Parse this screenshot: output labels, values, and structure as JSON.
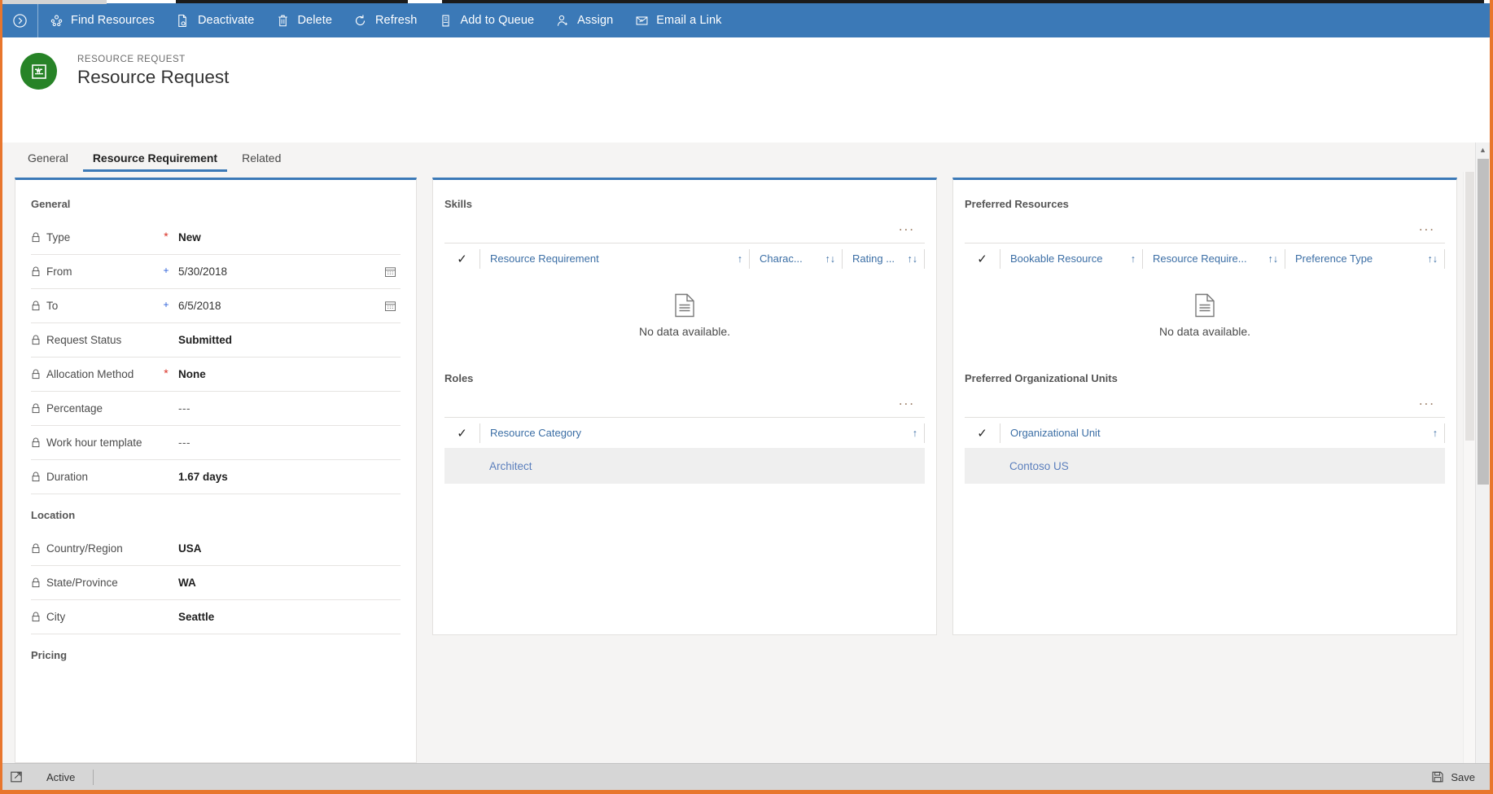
{
  "commandbar": {
    "nav_icon": "chevron-right-circle-icon",
    "buttons": [
      {
        "label": "Find Resources",
        "icon": "find-resources-icon"
      },
      {
        "label": "Deactivate",
        "icon": "deactivate-icon"
      },
      {
        "label": "Delete",
        "icon": "trash-icon"
      },
      {
        "label": "Refresh",
        "icon": "refresh-icon"
      },
      {
        "label": "Add to Queue",
        "icon": "add-to-queue-icon"
      },
      {
        "label": "Assign",
        "icon": "assign-person-icon"
      },
      {
        "label": "Email a Link",
        "icon": "email-link-icon"
      }
    ]
  },
  "record_header": {
    "eyebrow": "RESOURCE REQUEST",
    "title": "Resource Request",
    "avatar_icon": "resource-request-entity-icon",
    "avatar_color": "#278327"
  },
  "tabs": [
    {
      "label": "General",
      "selected": false
    },
    {
      "label": "Resource Requirement",
      "selected": true
    },
    {
      "label": "Related",
      "selected": false
    }
  ],
  "form": {
    "sections": [
      {
        "title": "General"
      },
      {
        "title": "Location"
      },
      {
        "title": "Pricing"
      }
    ],
    "fields": {
      "type": {
        "label": "Type",
        "value": "New",
        "required": "star",
        "locked": true
      },
      "from": {
        "label": "From",
        "value": "5/30/2018",
        "required": "plus",
        "locked": true,
        "calendar": true
      },
      "to": {
        "label": "To",
        "value": "6/5/2018",
        "required": "plus",
        "locked": true,
        "calendar": true
      },
      "request_status": {
        "label": "Request Status",
        "value": "Submitted",
        "required": "",
        "locked": true
      },
      "allocation": {
        "label": "Allocation Method",
        "value": "None",
        "required": "star",
        "locked": true
      },
      "percentage": {
        "label": "Percentage",
        "value": "---",
        "required": "",
        "locked": true
      },
      "work_hour": {
        "label": "Work hour template",
        "value": "---",
        "required": "",
        "locked": true
      },
      "duration": {
        "label": "Duration",
        "value": "1.67 days",
        "required": "",
        "locked": true
      },
      "country": {
        "label": "Country/Region",
        "value": "USA",
        "required": "",
        "locked": true
      },
      "state": {
        "label": "State/Province",
        "value": "WA",
        "required": "",
        "locked": true
      },
      "city": {
        "label": "City",
        "value": "Seattle",
        "required": "",
        "locked": true
      }
    }
  },
  "skills_grid": {
    "title": "Skills",
    "more_label": "...",
    "columns": [
      {
        "label": "Resource Requirement",
        "sort": "↑"
      },
      {
        "label": "Charac...",
        "sort": "↑↓"
      },
      {
        "label": "Rating ...",
        "sort": "↑↓"
      }
    ],
    "empty_text": "No data available.",
    "empty_icon": "document-empty-icon"
  },
  "roles_grid": {
    "title": "Roles",
    "more_label": "...",
    "columns": [
      {
        "label": "Resource Category",
        "sort": "↑"
      }
    ],
    "rows": [
      {
        "resource_category": "Architect"
      }
    ]
  },
  "preferred_resources_grid": {
    "title": "Preferred Resources",
    "more_label": "...",
    "columns": [
      {
        "label": "Bookable Resource",
        "sort": "↑"
      },
      {
        "label": "Resource Require...",
        "sort": "↑↓"
      },
      {
        "label": "Preference Type",
        "sort": "↑↓"
      }
    ],
    "empty_text": "No data available.",
    "empty_icon": "document-empty-icon"
  },
  "preferred_org_units_grid": {
    "title": "Preferred Organizational Units",
    "more_label": "...",
    "columns": [
      {
        "label": "Organizational Unit",
        "sort": "↑"
      }
    ],
    "rows": [
      {
        "organizational_unit": "Contoso US"
      }
    ]
  },
  "footer": {
    "popout_icon": "popout-icon",
    "status": "Active",
    "save_label": "Save",
    "save_icon": "save-disk-icon"
  },
  "colors": {
    "command_bar": "#3b79b7",
    "accent_border": "#3b79b7",
    "entity_green": "#278327",
    "required_star": "#d93025",
    "link_blue": "#3b6ea5",
    "window_edge_orange": "#e8762d"
  }
}
